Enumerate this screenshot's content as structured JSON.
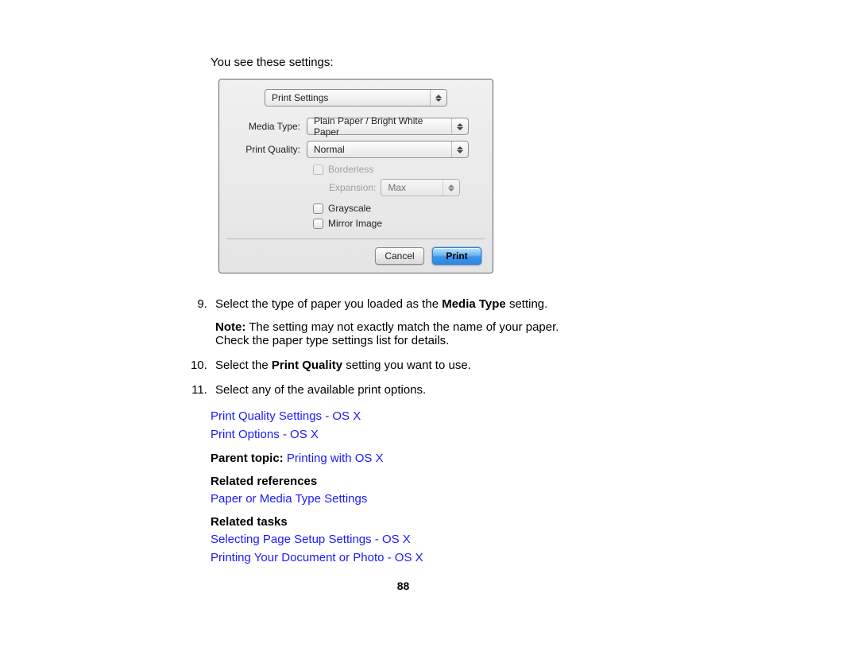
{
  "intro": "You see these settings:",
  "dialog": {
    "section_select": "Print Settings",
    "media_type_label": "Media Type:",
    "media_type_value": "Plain Paper / Bright White Paper",
    "print_quality_label": "Print Quality:",
    "print_quality_value": "Normal",
    "borderless_label": "Borderless",
    "expansion_label": "Expansion:",
    "expansion_value": "Max",
    "grayscale_label": "Grayscale",
    "mirror_label": "Mirror Image",
    "cancel": "Cancel",
    "print": "Print"
  },
  "steps": {
    "s9_pre": "Select the type of paper you loaded as the ",
    "s9_bold": "Media Type",
    "s9_post": " setting.",
    "note_label": "Note:",
    "note_body": " The setting may not exactly match the name of your paper. Check the paper type settings list for details.",
    "s10_pre": "Select the ",
    "s10_bold": "Print Quality",
    "s10_post": " setting you want to use.",
    "s11": "Select any of the available print options."
  },
  "links": {
    "pq": "Print Quality Settings - OS X",
    "po": "Print Options - OS X",
    "parent_label": "Parent topic:",
    "parent_link": "Printing with OS X",
    "ref_label": "Related references",
    "ref1": "Paper or Media Type Settings",
    "task_label": "Related tasks",
    "task1": "Selecting Page Setup Settings - OS X",
    "task2": "Printing Your Document or Photo - OS X"
  },
  "page_number": "88"
}
